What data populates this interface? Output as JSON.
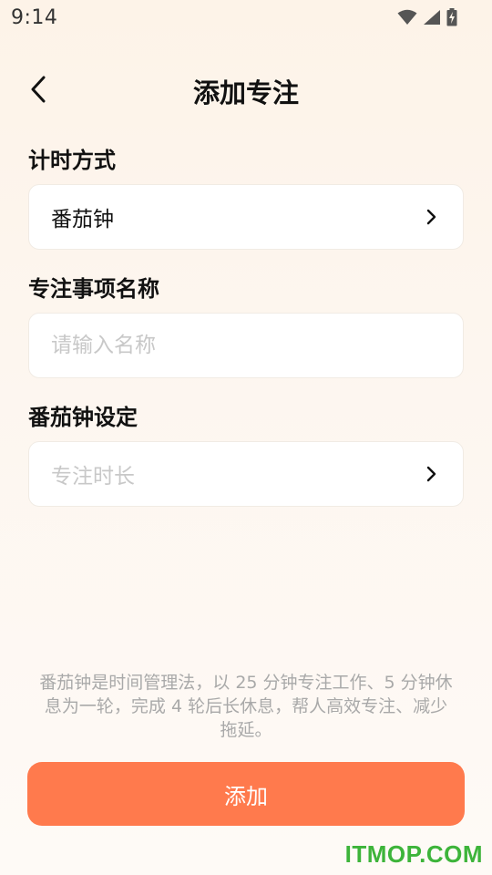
{
  "status_bar": {
    "time": "9:14",
    "icons": [
      "wifi-icon",
      "signal-icon",
      "battery-charging-icon"
    ]
  },
  "header": {
    "title": "添加专注",
    "back_icon": "chevron-left-icon"
  },
  "form": {
    "timer_mode": {
      "label": "计时方式",
      "value": "番茄钟"
    },
    "task_name": {
      "label": "专注事项名称",
      "placeholder": "请输入名称",
      "value": ""
    },
    "pomodoro_settings": {
      "label": "番茄钟设定",
      "placeholder": "专注时长"
    }
  },
  "hint": "番茄钟是时间管理法，以 25 分钟专注工作、5 分钟休息为一轮，完成 4 轮后长休息，帮人高效专注、减少拖延。",
  "add_button": {
    "label": "添加"
  },
  "watermark": "ITMOP.COM",
  "colors": {
    "accent": "#ff7a4d",
    "background_top": "#fdf3e8",
    "card": "#ffffff",
    "placeholder": "#c8c8c8",
    "watermark": "#3db43a"
  }
}
